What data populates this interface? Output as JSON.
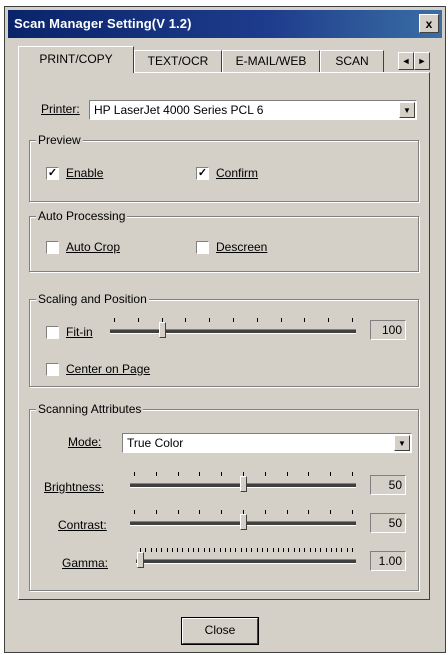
{
  "window": {
    "title": "Scan Manager Setting(V 1.2)",
    "close_glyph": "x"
  },
  "tabs": [
    {
      "label": "PRINT/COPY",
      "active": true
    },
    {
      "label": "TEXT/OCR",
      "active": false
    },
    {
      "label": "E-MAIL/WEB",
      "active": false
    },
    {
      "label": "SCAN",
      "active": false
    }
  ],
  "tab_scroll": {
    "left_glyph": "◄",
    "right_glyph": "►"
  },
  "printer": {
    "label": "Printer:",
    "value": "HP LaserJet 4000 Series PCL 6"
  },
  "preview": {
    "title": "Preview",
    "enable": {
      "label": "Enable",
      "checked": true
    },
    "confirm": {
      "label": "Confirm",
      "checked": true
    }
  },
  "auto_processing": {
    "title": "Auto Processing",
    "auto_crop": {
      "label": "Auto Crop",
      "checked": false
    },
    "descreen": {
      "label": "Descreen",
      "checked": false
    }
  },
  "scaling": {
    "title": "Scaling and Position",
    "fit_in": {
      "label": "Fit-in",
      "checked": false,
      "value": "100",
      "level": 0.2,
      "ticks": 11
    },
    "center": {
      "label": "Center on Page",
      "checked": false
    }
  },
  "attributes": {
    "title": "Scanning Attributes",
    "mode": {
      "label": "Mode:",
      "value": "True Color"
    },
    "brightness": {
      "label": "Brightness:",
      "value": "50",
      "level": 0.5,
      "ticks": 11
    },
    "contrast": {
      "label": "Contrast:",
      "value": "50",
      "level": 0.5,
      "ticks": 11
    },
    "gamma": {
      "label": "Gamma:",
      "value": "1.00",
      "level": 0.0,
      "ticks": 41
    }
  },
  "close_button": {
    "label": "Close"
  },
  "icons": {
    "checkmark": "check-icon",
    "dropdown": "chevron-down-icon"
  }
}
